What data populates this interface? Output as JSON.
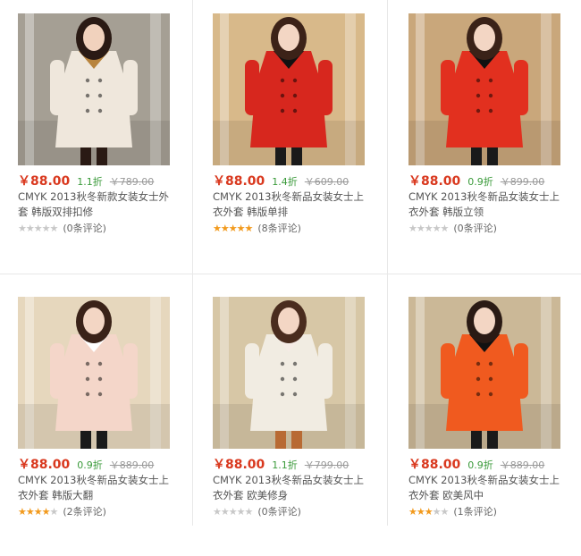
{
  "products": [
    {
      "price": "￥88.00",
      "discount": "1.1折",
      "old_price": "￥789.00",
      "title": "CMYK 2013秋冬新款女装女士外套 韩版双排扣修",
      "rating": 0,
      "reviews": "(0条评论)",
      "photo": {
        "bg": "#a59f94",
        "coat": "#efe7dc",
        "hair": "#2a1a14",
        "skin": "#f1d2bd",
        "accent": "#b8843d",
        "legs": "#2a1a14"
      }
    },
    {
      "price": "￥88.00",
      "discount": "1.4折",
      "old_price": "￥609.00",
      "title": "CMYK 2013秋冬新品女装女士上衣外套 韩版单排",
      "rating": 5,
      "reviews": "(8条评论)",
      "photo": {
        "bg": "#d8b98a",
        "coat": "#d7271e",
        "hair": "#3c2218",
        "skin": "#f3d6c4",
        "accent": "#111111",
        "legs": "#1a1a1a"
      }
    },
    {
      "price": "￥88.00",
      "discount": "0.9折",
      "old_price": "￥899.00",
      "title": "CMYK 2013秋冬新品女装女士上衣外套 韩版立领",
      "rating": 0,
      "reviews": "(0条评论)",
      "photo": {
        "bg": "#c9a77b",
        "coat": "#e2301f",
        "hair": "#3a2218",
        "skin": "#f3d6c4",
        "accent": "#111111",
        "legs": "#1a1a1a"
      }
    },
    {
      "price": "￥88.00",
      "discount": "0.9折",
      "old_price": "￥889.00",
      "title": "CMYK 2013秋冬新品女装女士上衣外套 韩版大翻",
      "rating": 4,
      "reviews": "(2条评论)",
      "photo": {
        "bg": "#e6d7bd",
        "coat": "#f4d6c9",
        "hair": "#3a2218",
        "skin": "#f3d6c4",
        "accent": "#ffffff",
        "legs": "#1a1a1a"
      }
    },
    {
      "price": "￥88.00",
      "discount": "1.1折",
      "old_price": "￥799.00",
      "title": "CMYK 2013秋冬新品女装女士上衣外套 欧美修身",
      "rating": 0,
      "reviews": "(0条评论)",
      "photo": {
        "bg": "#d7c7a6",
        "coat": "#f1ece2",
        "hair": "#4a2c1e",
        "skin": "#f3d6c4",
        "accent": "#f5ebe5",
        "legs": "#b86a33"
      }
    },
    {
      "price": "￥88.00",
      "discount": "0.9折",
      "old_price": "￥889.00",
      "title": "CMYK 2013秋冬新品女装女士上衣外套 欧美风中",
      "rating": 3,
      "reviews": "(1条评论)",
      "photo": {
        "bg": "#cbb897",
        "coat": "#f05a1f",
        "hair": "#2a1a14",
        "skin": "#f3d6c4",
        "accent": "#111111",
        "legs": "#1a1a1a"
      }
    }
  ]
}
